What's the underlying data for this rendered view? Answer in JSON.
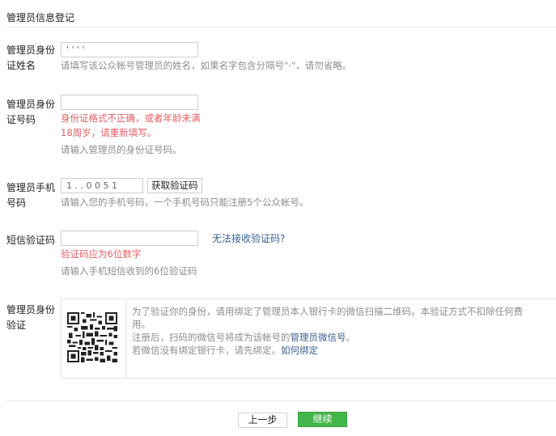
{
  "page_title": "管理员信息登记",
  "name_section": {
    "label_line1": "管理员身份",
    "label_line2": "证姓名",
    "value": "'  ' ' '",
    "hint": "请填写该公众帐号管理员的姓名，如果名字包含分隔号\"·\"，请勿省略。"
  },
  "id_section": {
    "label_line1": "管理员身份",
    "label_line2": "证号码",
    "value": "",
    "error_line1": "身份证格式不正确，或者年龄未满",
    "error_line2": "18周岁，请重新填写。",
    "hint": "请输入管理员的身份证号码。"
  },
  "phone_section": {
    "label_line1": "管理员手机",
    "label_line2": "号码",
    "value": "1 . . 0 0 5 1",
    "get_code_label": "获取验证码",
    "hint": "请输入您的手机号码，一个手机号码只能注册5个公众帐号。"
  },
  "sms_section": {
    "label": "短信验证码",
    "value": "",
    "no_code_link": "无法接收验证码?",
    "error": "验证码应为6位数字",
    "hint": "请输入手机短信收到的6位验证码"
  },
  "verify_section": {
    "label_line1": "管理员身份",
    "label_line2": "验证",
    "qr_icon": "qr-code-icon",
    "text_line1": "为了验证你的身份，请用绑定了管理员本人银行卡的微信扫描二维码。本验证方式不扣除任何费",
    "text_line2": "用。",
    "text_line3_prefix": "注册后，扫码的微信号将成为该帐号的",
    "text_line3_link": "管理员微信号",
    "text_line3_suffix": "。",
    "text_line4_prefix": "若微信没有绑定银行卡，请先绑定。",
    "text_line4_link": "如何绑定"
  },
  "footer": {
    "prev_label": "上一步",
    "next_label": "继续"
  },
  "colors": {
    "error": "#e15f63",
    "link": "#3b5f8f",
    "primary_button": "#44b549",
    "hint": "#8d8d8d"
  }
}
